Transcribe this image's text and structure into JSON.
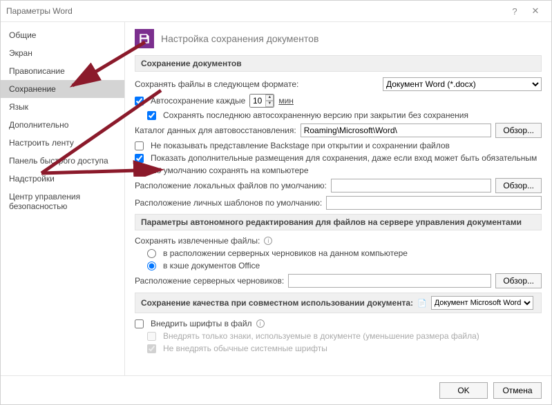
{
  "title": "Параметры Word",
  "sidebar": {
    "items": [
      {
        "label": "Общие"
      },
      {
        "label": "Экран"
      },
      {
        "label": "Правописание"
      },
      {
        "label": "Сохранение"
      },
      {
        "label": "Язык"
      },
      {
        "label": "Дополнительно"
      },
      {
        "label": "Настроить ленту"
      },
      {
        "label": "Панель быстрого доступа"
      },
      {
        "label": "Надстройки"
      },
      {
        "label": "Центр управления безопасностью"
      }
    ],
    "selected_index": 3
  },
  "page_header": "Настройка сохранения документов",
  "section_save": {
    "title": "Сохранение документов",
    "format_label": "Сохранять файлы в следующем формате:",
    "format_value": "Документ Word (*.docx)",
    "autosave_label": "Автосохранение каждые",
    "autosave_value": "10",
    "autosave_unit": "мин",
    "keep_last_label": "Сохранять последнюю автосохраненную версию при закрытии без сохранения",
    "catalog_label": "Каталог данных для автовосстановления:",
    "catalog_value": "Roaming\\Microsoft\\Word\\",
    "browse": "Обзор...",
    "no_backstage": "Не показывать представление Backstage при открытии и сохранении файлов",
    "show_extra": "Показать дополнительные размещения для сохранения, даже если вход может быть обязательным",
    "default_local": "По умолчанию сохранять на компьютере",
    "local_loc_label": "Расположение локальных файлов по умолчанию:",
    "personal_tpl_label": "Расположение личных шаблонов по умолчанию:"
  },
  "section_offline": {
    "title": "Параметры автономного редактирования для файлов на сервере управления документами",
    "save_extracted_label": "Сохранять извлеченные файлы:",
    "opt_server": "в расположении серверных черновиков на данном компьютере",
    "opt_cache": "в кэше документов Office",
    "server_drafts_label": "Расположение серверных черновиков:",
    "browse": "Обзор..."
  },
  "section_quality": {
    "title": "Сохранение качества при совместном использовании документа:",
    "doc_sel": "Документ Microsoft Word",
    "embed_fonts": "Внедрить шрифты в файл",
    "embed_used_only": "Внедрять только знаки, используемые в документе (уменьшение размера файла)",
    "no_system_fonts": "Не внедрять обычные системные шрифты"
  },
  "footer": {
    "ok": "OK",
    "cancel": "Отмена"
  }
}
